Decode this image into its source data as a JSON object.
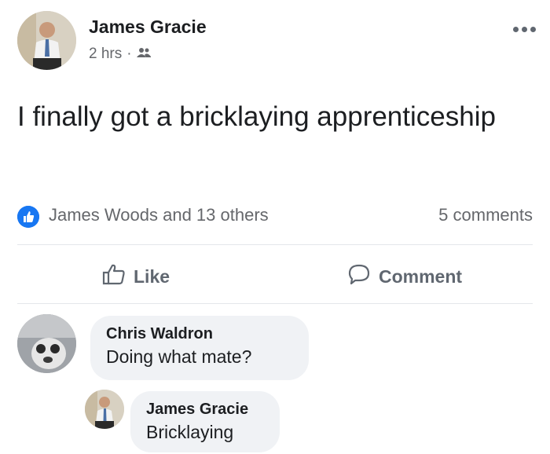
{
  "post": {
    "author": "James Gracie",
    "time": "2 hrs",
    "separator": "·",
    "audience_icon": "friends-icon",
    "text": "I finally got a bricklaying apprenticeship",
    "reactions": {
      "icon": "like-badge-icon",
      "summary": "James Woods and 13 others",
      "comment_count": "5 comments"
    },
    "actions": {
      "like_label": "Like",
      "comment_label": "Comment"
    }
  },
  "comments": [
    {
      "author": "Chris Waldron",
      "text": "Doing what mate?"
    },
    {
      "author": "James Gracie",
      "text": "Bricklaying"
    }
  ],
  "colors": {
    "accent": "#1877f2",
    "secondary_text": "#65676b",
    "bubble": "#f0f2f5"
  }
}
